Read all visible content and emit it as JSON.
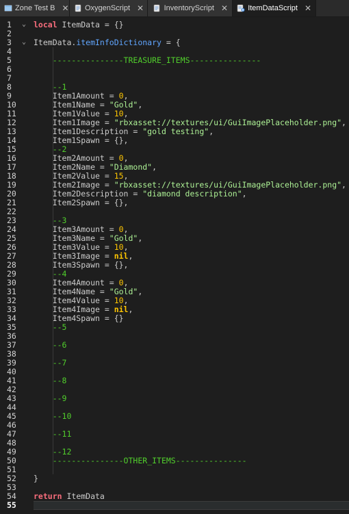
{
  "tabs": [
    {
      "label": "Zone Test B",
      "icon": "folder-icon",
      "active": false
    },
    {
      "label": "OxygenScript",
      "icon": "script-icon",
      "active": false
    },
    {
      "label": "InventoryScript",
      "icon": "script-icon",
      "active": false
    },
    {
      "label": "ItemDataScript",
      "icon": "local-script-icon",
      "active": true
    }
  ],
  "close_glyph": "✕",
  "current_line": 55,
  "lines": [
    [
      [
        "kw",
        "local"
      ],
      [
        "id",
        " ItemData = {}"
      ]
    ],
    [],
    [
      [
        "id",
        "ItemData."
      ],
      [
        "prop",
        "itemInfoDictionary"
      ],
      [
        "id",
        " = {"
      ]
    ],
    [],
    [
      [
        "id",
        "    "
      ],
      [
        "cmt",
        "---------------TREASURE_ITEMS---------------"
      ]
    ],
    [],
    [],
    [
      [
        "id",
        "    "
      ],
      [
        "cmt",
        "--1"
      ]
    ],
    [
      [
        "id",
        "    Item1Amount = "
      ],
      [
        "num",
        "0"
      ],
      [
        "id",
        ","
      ]
    ],
    [
      [
        "id",
        "    Item1Name = "
      ],
      [
        "str",
        "\"Gold\""
      ],
      [
        "id",
        ","
      ]
    ],
    [
      [
        "id",
        "    Item1Value = "
      ],
      [
        "num",
        "10"
      ],
      [
        "id",
        ","
      ]
    ],
    [
      [
        "id",
        "    Item1Image = "
      ],
      [
        "str",
        "\"rbxasset://textures/ui/GuiImagePlaceholder.png\""
      ],
      [
        "id",
        ","
      ]
    ],
    [
      [
        "id",
        "    Item1Description = "
      ],
      [
        "str",
        "\"gold testing\""
      ],
      [
        "id",
        ","
      ]
    ],
    [
      [
        "id",
        "    Item1Spawn = {},"
      ]
    ],
    [
      [
        "id",
        "    "
      ],
      [
        "cmt",
        "--2"
      ]
    ],
    [
      [
        "id",
        "    Item2Amount = "
      ],
      [
        "num",
        "0"
      ],
      [
        "id",
        ","
      ]
    ],
    [
      [
        "id",
        "    Item2Name = "
      ],
      [
        "str",
        "\"Diamond\""
      ],
      [
        "id",
        ","
      ]
    ],
    [
      [
        "id",
        "    Item2Value = "
      ],
      [
        "num",
        "15"
      ],
      [
        "id",
        ","
      ]
    ],
    [
      [
        "id",
        "    Item2Image = "
      ],
      [
        "str",
        "\"rbxasset://textures/ui/GuiImagePlaceholder.png\""
      ],
      [
        "id",
        ","
      ]
    ],
    [
      [
        "id",
        "    Item2Description = "
      ],
      [
        "str",
        "\"diamond description\""
      ],
      [
        "id",
        ","
      ]
    ],
    [
      [
        "id",
        "    Item2Spawn = {},"
      ]
    ],
    [],
    [
      [
        "id",
        "    "
      ],
      [
        "cmt",
        "--3"
      ]
    ],
    [
      [
        "id",
        "    Item3Amount = "
      ],
      [
        "num",
        "0"
      ],
      [
        "id",
        ","
      ]
    ],
    [
      [
        "id",
        "    Item3Name = "
      ],
      [
        "str",
        "\"Gold\""
      ],
      [
        "id",
        ","
      ]
    ],
    [
      [
        "id",
        "    Item3Value = "
      ],
      [
        "num",
        "10"
      ],
      [
        "id",
        ","
      ]
    ],
    [
      [
        "id",
        "    Item3Image = "
      ],
      [
        "nil",
        "nil"
      ],
      [
        "id",
        ","
      ]
    ],
    [
      [
        "id",
        "    Item3Spawn = {},"
      ]
    ],
    [
      [
        "id",
        "    "
      ],
      [
        "cmt",
        "--4"
      ]
    ],
    [
      [
        "id",
        "    Item4Amount = "
      ],
      [
        "num",
        "0"
      ],
      [
        "id",
        ","
      ]
    ],
    [
      [
        "id",
        "    Item4Name = "
      ],
      [
        "str",
        "\"Gold\""
      ],
      [
        "id",
        ","
      ]
    ],
    [
      [
        "id",
        "    Item4Value = "
      ],
      [
        "num",
        "10"
      ],
      [
        "id",
        ","
      ]
    ],
    [
      [
        "id",
        "    Item4Image = "
      ],
      [
        "nil",
        "nil"
      ],
      [
        "id",
        ","
      ]
    ],
    [
      [
        "id",
        "    Item4Spawn = {}"
      ]
    ],
    [
      [
        "id",
        "    "
      ],
      [
        "cmt",
        "--5"
      ]
    ],
    [],
    [
      [
        "id",
        "    "
      ],
      [
        "cmt",
        "--6"
      ]
    ],
    [],
    [
      [
        "id",
        "    "
      ],
      [
        "cmt",
        "--7"
      ]
    ],
    [],
    [
      [
        "id",
        "    "
      ],
      [
        "cmt",
        "--8"
      ]
    ],
    [],
    [
      [
        "id",
        "    "
      ],
      [
        "cmt",
        "--9"
      ]
    ],
    [],
    [
      [
        "id",
        "    "
      ],
      [
        "cmt",
        "--10"
      ]
    ],
    [],
    [
      [
        "id",
        "    "
      ],
      [
        "cmt",
        "--11"
      ]
    ],
    [],
    [
      [
        "id",
        "    "
      ],
      [
        "cmt",
        "--12"
      ]
    ],
    [
      [
        "id",
        "    "
      ],
      [
        "cmt",
        "---------------OTHER_ITEMS---------------"
      ]
    ],
    [],
    [
      [
        "id",
        "}"
      ]
    ],
    [],
    [
      [
        "kw",
        "return"
      ],
      [
        "id",
        " ItemData"
      ]
    ],
    []
  ],
  "fold_markers": [
    1,
    3
  ]
}
